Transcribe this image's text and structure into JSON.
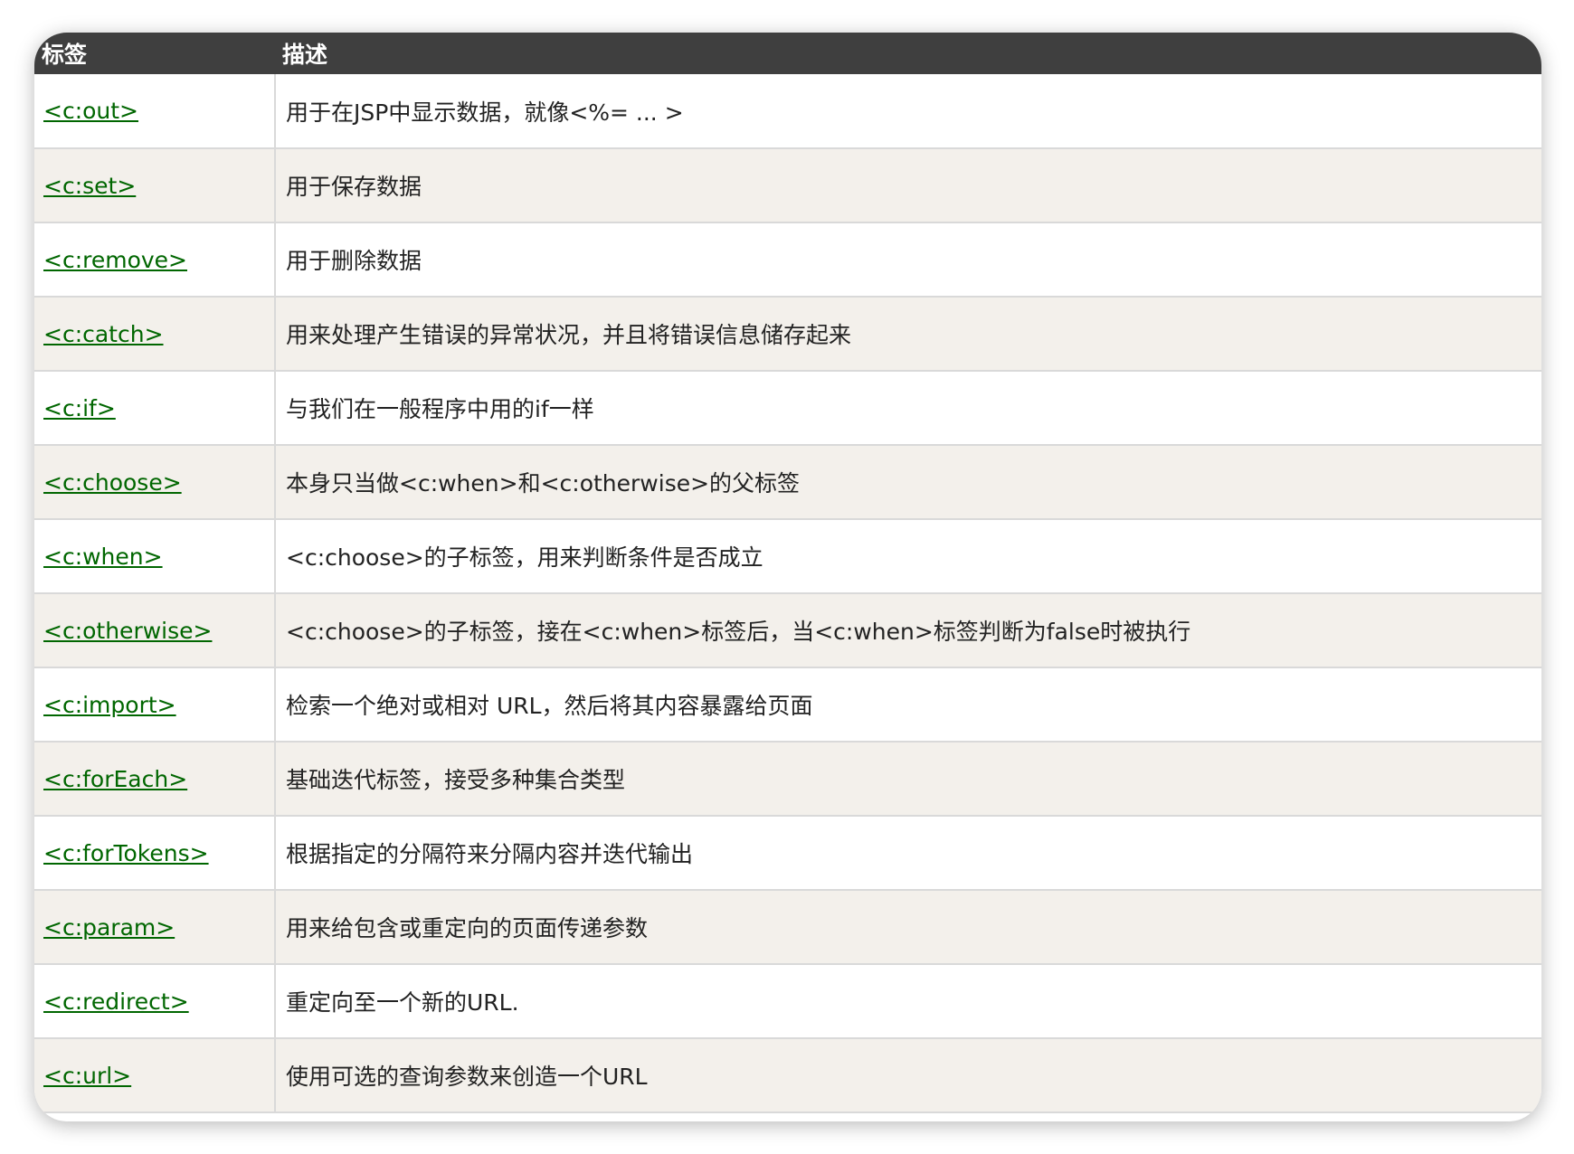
{
  "table": {
    "headers": [
      "标签",
      "描述"
    ],
    "rows": [
      {
        "tag": "<c:out>",
        "desc": "用于在JSP中显示数据，就像<%= ... >"
      },
      {
        "tag": "<c:set>",
        "desc": "用于保存数据"
      },
      {
        "tag": "<c:remove>",
        "desc": "用于删除数据"
      },
      {
        "tag": "<c:catch>",
        "desc": "用来处理产生错误的异常状况，并且将错误信息储存起来"
      },
      {
        "tag": "<c:if>",
        "desc": "与我们在一般程序中用的if一样"
      },
      {
        "tag": "<c:choose>",
        "desc": "本身只当做<c:when>和<c:otherwise>的父标签"
      },
      {
        "tag": "<c:when>",
        "desc": "<c:choose>的子标签，用来判断条件是否成立"
      },
      {
        "tag": "<c:otherwise>",
        "desc": "<c:choose>的子标签，接在<c:when>标签后，当<c:when>标签判断为false时被执行"
      },
      {
        "tag": "<c:import>",
        "desc": "检索一个绝对或相对 URL，然后将其内容暴露给页面"
      },
      {
        "tag": "<c:forEach>",
        "desc": "基础迭代标签，接受多种集合类型"
      },
      {
        "tag": "<c:forTokens>",
        "desc": "根据指定的分隔符来分隔内容并迭代输出"
      },
      {
        "tag": "<c:param>",
        "desc": "用来给包含或重定向的页面传递参数"
      },
      {
        "tag": "<c:redirect>",
        "desc": "重定向至一个新的URL."
      },
      {
        "tag": "<c:url>",
        "desc": "使用可选的查询参数来创造一个URL"
      }
    ]
  },
  "colors": {
    "header_bg": "#3f3f3f",
    "link": "#006600",
    "row_alt": "#f3f0eb"
  }
}
